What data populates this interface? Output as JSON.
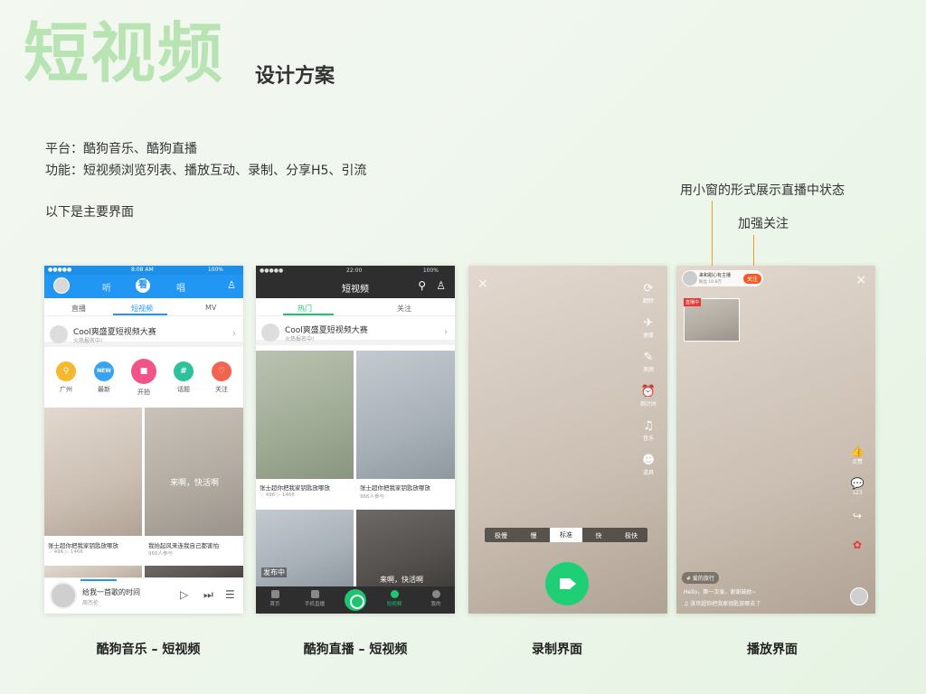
{
  "header": {
    "title": "短视频",
    "subtitle": "设计方案"
  },
  "description": {
    "platform": "平台：酷狗音乐、酷狗直播",
    "features": "功能：短视频浏览列表、播放互动、录制、分享H5、引流",
    "intro": "以下是主要界面"
  },
  "annotations": {
    "live_window": "用小窗的形式展示直播中状态",
    "follow": "加强关注"
  },
  "captions": {
    "music": "酷狗音乐 – 短视频",
    "live": "酷狗直播 – 短视频",
    "record": "录制界面",
    "play": "播放界面"
  },
  "phone_music": {
    "status_time": "8:08 AM",
    "status_battery": "100%",
    "status_carrier": "●●●●● ",
    "top_tabs": [
      "听",
      "看",
      "唱"
    ],
    "sub_tabs": [
      "直播",
      "短视频",
      "MV"
    ],
    "banner_title": "Cool爽盛夏短视频大赛",
    "banner_sub": "火热报名中!",
    "icons": [
      {
        "label": "广州",
        "glyph": "⚲",
        "color": "#f5b82e"
      },
      {
        "label": "最新",
        "glyph": "NEW",
        "color": "#3aa3f0"
      },
      {
        "label": "开拍",
        "glyph": "■",
        "color": "#f25487"
      },
      {
        "label": "话题",
        "glyph": "#",
        "color": "#2cc29b"
      },
      {
        "label": "关注",
        "glyph": "♡",
        "color": "#f4634f"
      }
    ],
    "cells": [
      {
        "title": "张士超你把我家钥匙放哪放",
        "meta": "♡ 496  ▷ 1466"
      },
      {
        "title": "我抬起风来连我自己都害怕",
        "meta": "966人参与"
      }
    ],
    "overlay_text": "来啊，快活啊",
    "player_title": "给我一首歌的时间",
    "player_artist": "周杰伦"
  },
  "phone_live": {
    "status_time": "22:00",
    "status_battery": "100%",
    "title": "短视频",
    "tabs": [
      "热门",
      "关注"
    ],
    "banner_title": "Cool爽盛夏短视频大赛",
    "banner_sub": "火热报名中!",
    "cells": [
      {
        "title": "张士超你把我家钥匙放哪放",
        "meta": "♡ 496  ▷ 1466"
      },
      {
        "title": "张士超你把我家钥匙放哪放",
        "meta": "966人参与"
      }
    ],
    "nav": [
      "首页",
      "手机直播",
      "",
      "短视频",
      "我的"
    ],
    "overlay_live": "发布中",
    "overlay_text": "来啊，快活啊"
  },
  "phone_record": {
    "side_icons": [
      {
        "label": "翻转",
        "glyph": "⟳"
      },
      {
        "label": "速度",
        "glyph": "✈"
      },
      {
        "label": "美颜",
        "glyph": "✎"
      },
      {
        "label": "倒计时",
        "glyph": "⏰"
      },
      {
        "label": "音乐",
        "glyph": "♫"
      },
      {
        "label": "道具",
        "glyph": "☻"
      }
    ],
    "speeds": [
      "极慢",
      "慢",
      "标准",
      "快",
      "极快"
    ],
    "selected_speed": "标准"
  },
  "phone_play": {
    "host_name": "来和甜心有主播",
    "host_fans": "粉丝 10.8万",
    "follow_label": "关注",
    "live_tag": "直播中",
    "right_icons": [
      {
        "label": "点赞",
        "glyph": "👍"
      },
      {
        "label": "123",
        "glyph": "💬"
      },
      {
        "label": "",
        "glyph": "↪"
      }
    ],
    "topic": "# 爱的旅行",
    "comments": [
      "Hello，第一次录，谢谢鼓励~",
      "♫ 张世超你把我家钥匙放哪去了"
    ]
  }
}
